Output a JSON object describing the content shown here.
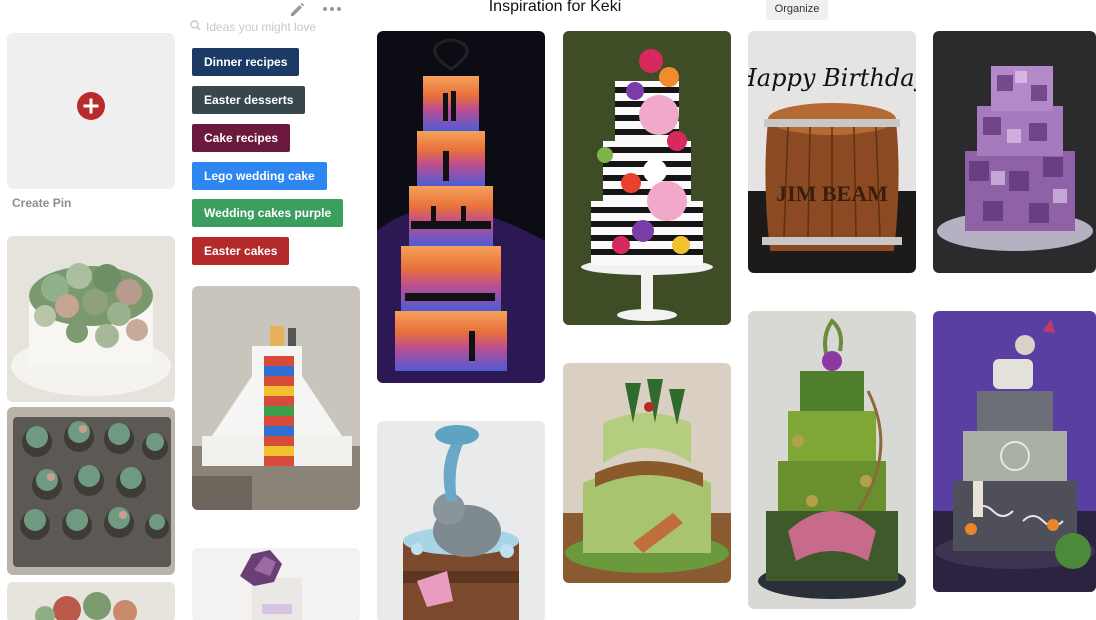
{
  "board": {
    "title": "Inspiration for Keki",
    "organize_label": "Organize"
  },
  "search": {
    "placeholder": "Ideas you might love"
  },
  "create_pin": {
    "label": "Create Pin"
  },
  "suggestion_chips": [
    {
      "label": "Dinner recipes",
      "color": "#1b3a66"
    },
    {
      "label": "Easter desserts",
      "color": "#37474b"
    },
    {
      "label": "Cake recipes",
      "color": "#6b1a3d"
    },
    {
      "label": "Lego wedding cake",
      "color": "#2e86f0"
    },
    {
      "label": "Wedding cakes purple",
      "color": "#3b9e5e"
    },
    {
      "label": "Easter cakes",
      "color": "#b42a2a"
    }
  ],
  "pin_text": {
    "birthday_topper": "Happy Birthday",
    "barrel_brand": "JIM BEAM"
  },
  "icons": [
    "pencil-icon",
    "more-icon",
    "search-icon",
    "plus-icon"
  ]
}
